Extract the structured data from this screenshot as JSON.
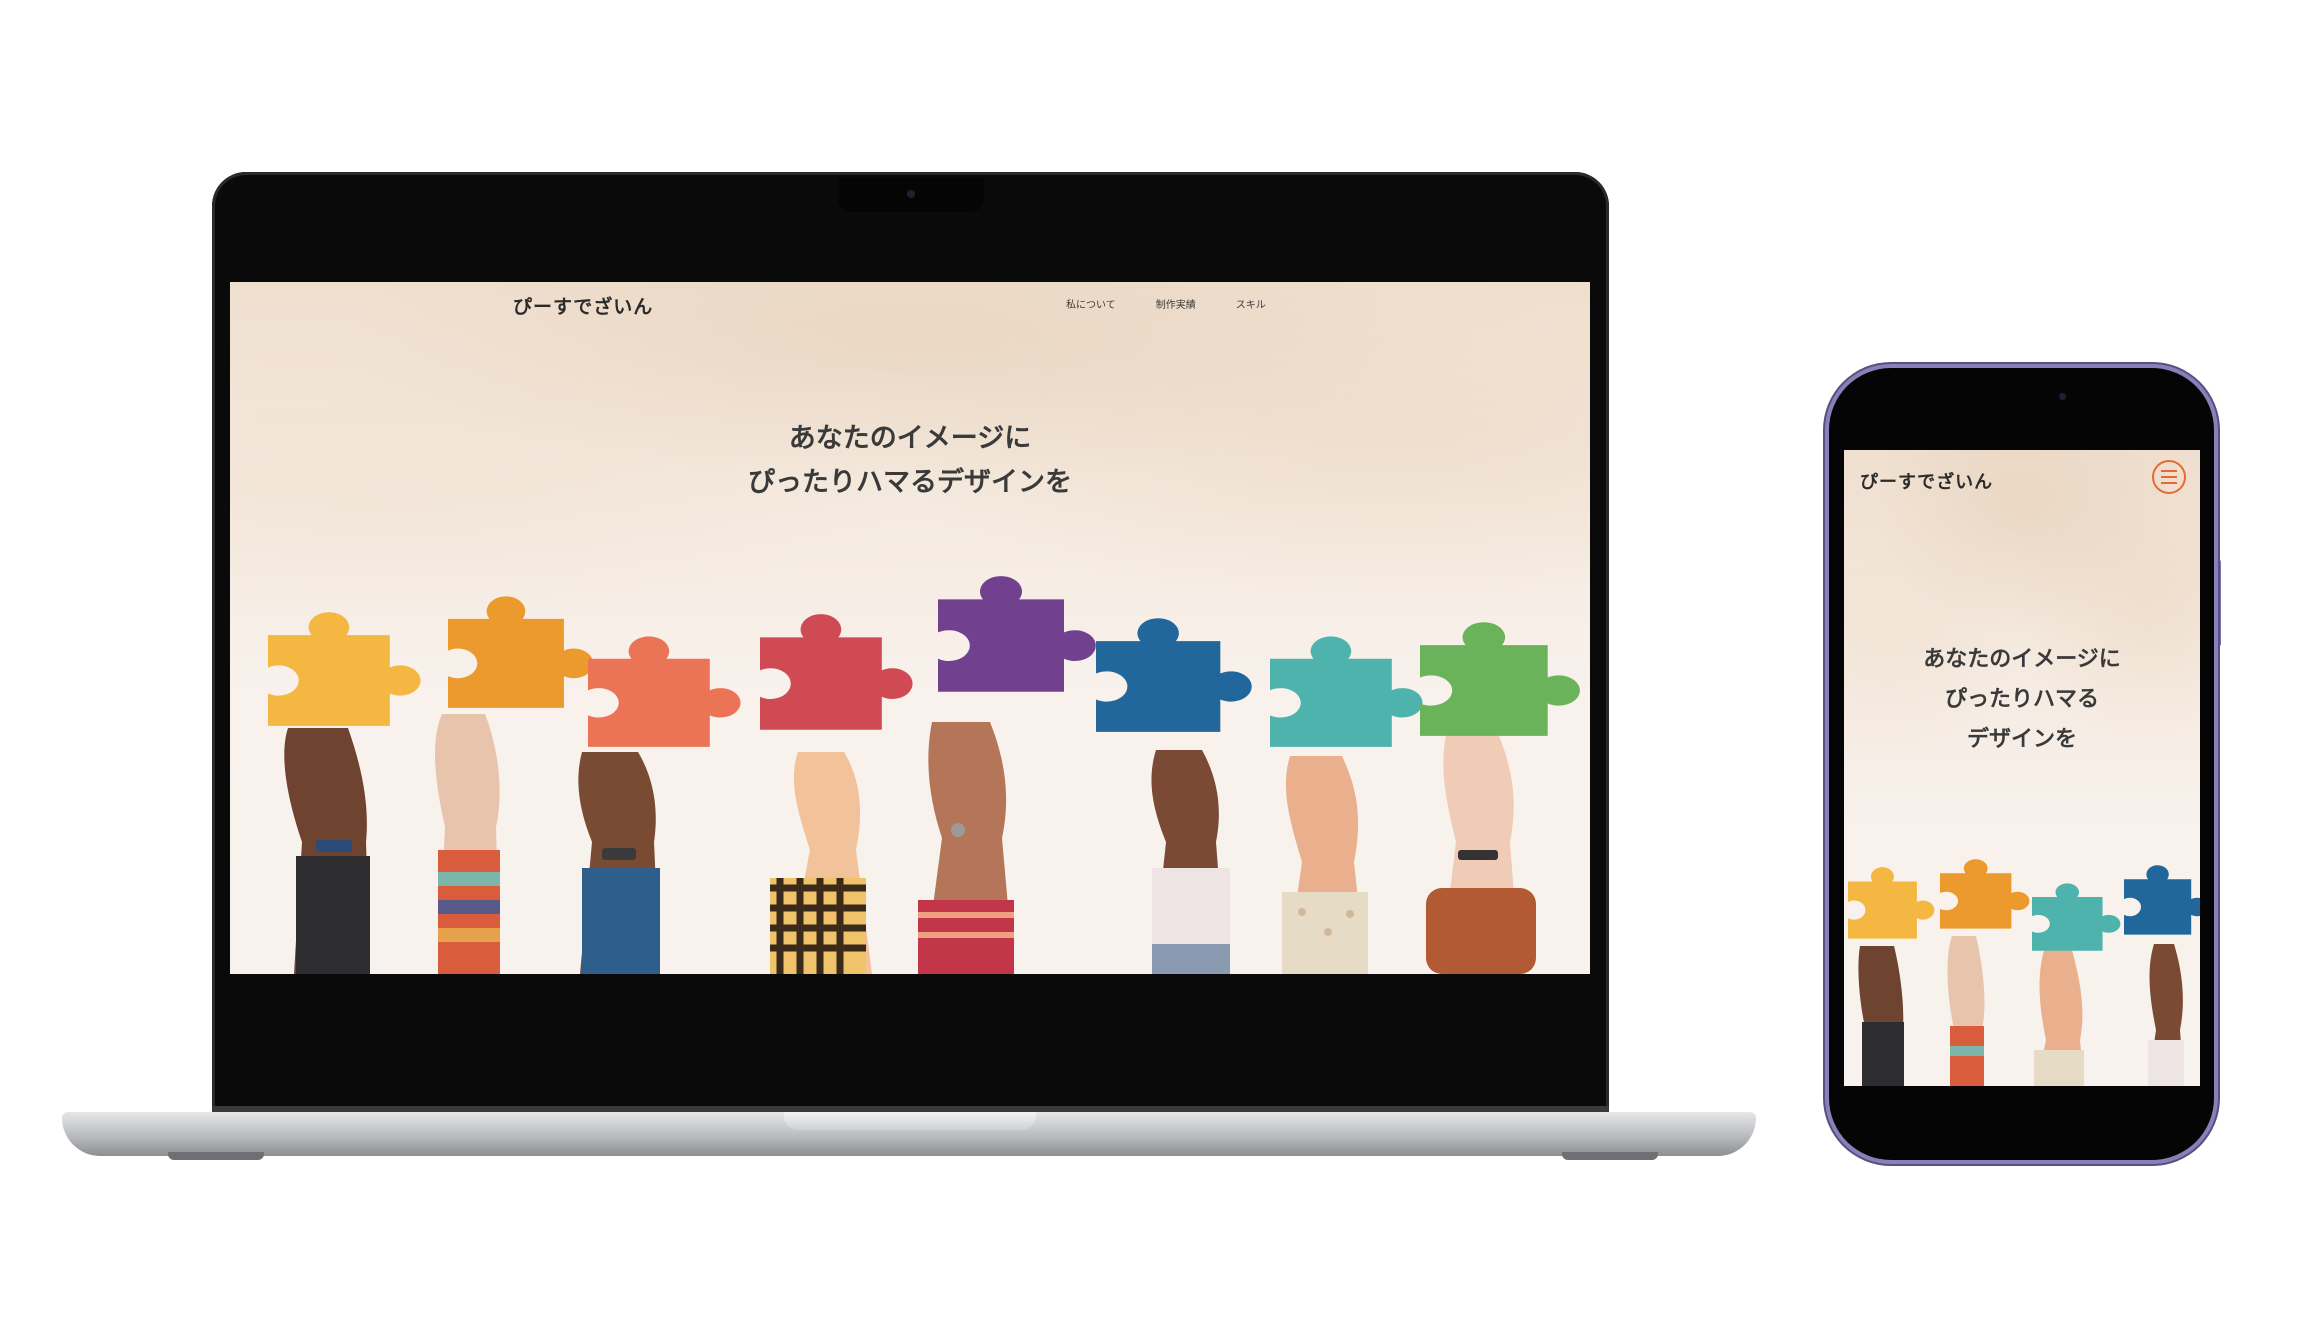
{
  "site": {
    "logo": "ぴーすでざいん",
    "nav": [
      "私について",
      "制作実績",
      "スキル"
    ],
    "hero_line1": "あなたのイメージに",
    "hero_line2": "ぴったりハマるデザインを",
    "mobile_hero_line1": "あなたのイメージに",
    "mobile_hero_line2": "ぴったりハマる",
    "mobile_hero_line3": "デザインを"
  },
  "colors": {
    "menu_accent": "#e66a32",
    "puzzle_yellow": "#f4b842",
    "puzzle_orange": "#ec9a2e",
    "puzzle_coral": "#ec7456",
    "puzzle_red": "#cf4a52",
    "puzzle_purple": "#71408f",
    "puzzle_blue": "#21679c",
    "puzzle_teal": "#4fb3ad",
    "puzzle_green": "#6ab35a"
  },
  "icons": {
    "menu": "hamburger-menu-icon"
  }
}
